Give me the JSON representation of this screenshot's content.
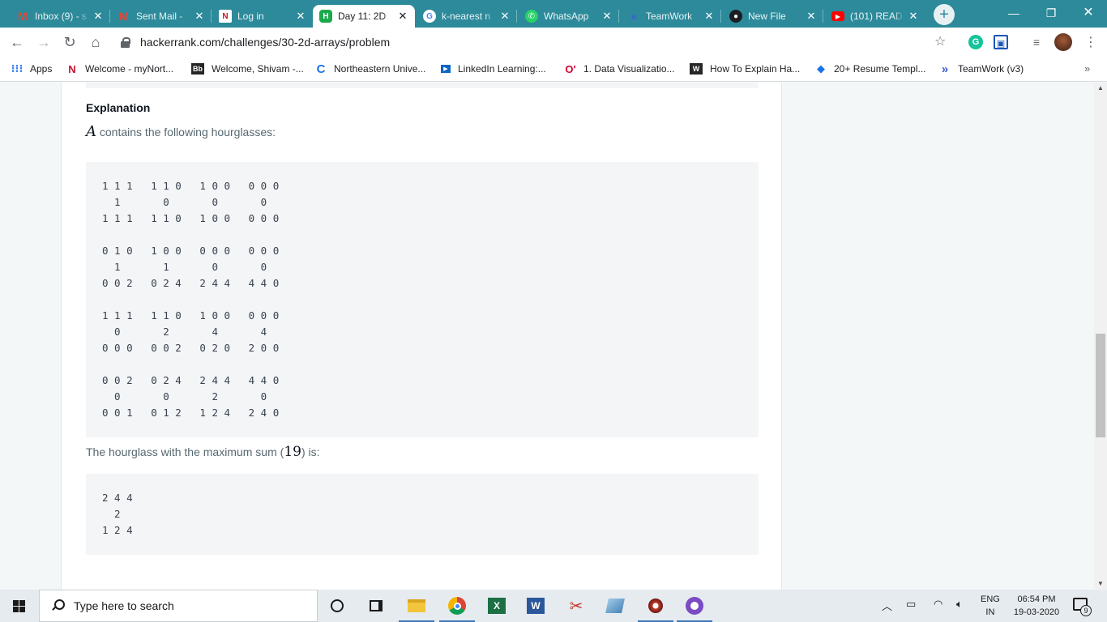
{
  "browser": {
    "tabs": [
      {
        "title": "Inbox (9) - s",
        "icon": "gmail-icon"
      },
      {
        "title": "Sent Mail -",
        "icon": "gmail-icon"
      },
      {
        "title": "Log in",
        "icon": "northeastern-icon"
      },
      {
        "title": "Day 11: 2D",
        "icon": "hackerrank-icon",
        "active": true
      },
      {
        "title": "k-nearest n",
        "icon": "google-icon"
      },
      {
        "title": "WhatsApp",
        "icon": "whatsapp-icon"
      },
      {
        "title": "TeamWork",
        "icon": "teamwork-icon"
      },
      {
        "title": "New File",
        "icon": "github-icon"
      },
      {
        "title": "(101) READ",
        "icon": "youtube-icon"
      }
    ],
    "new_tab_label": "+",
    "url": "hackerrank.com/challenges/30-2d-arrays/problem",
    "bookmarks": [
      {
        "label": "Apps",
        "icon": "apps-grid-icon"
      },
      {
        "label": "Welcome - myNort...",
        "icon": "northeastern-icon"
      },
      {
        "label": "Welcome, Shivam -...",
        "icon": "blackboard-icon"
      },
      {
        "label": "Northeastern Unive...",
        "icon": "northeastern-c-icon"
      },
      {
        "label": "LinkedIn Learning:...",
        "icon": "linkedin-learning-icon"
      },
      {
        "label": "1. Data Visualizatio...",
        "icon": "oreilly-icon"
      },
      {
        "label": "How To Explain Ha...",
        "icon": "wordpress-icon"
      },
      {
        "label": "20+ Resume Templ...",
        "icon": "bookmark-diamond-icon"
      },
      {
        "label": "TeamWork (v3)",
        "icon": "teamwork-icon"
      }
    ],
    "bookmarks_more": "»"
  },
  "page": {
    "heading": "Explanation",
    "intro_var": "A",
    "intro_text": " contains the following hourglasses:",
    "hourglasses": "1 1 1   1 1 0   1 0 0   0 0 0\n  1       0       0       0\n1 1 1   1 1 0   1 0 0   0 0 0\n\n0 1 0   1 0 0   0 0 0   0 0 0\n  1       1       0       0\n0 0 2   0 2 4   2 4 4   4 4 0\n\n1 1 1   1 1 0   1 0 0   0 0 0\n  0       2       4       4\n0 0 0   0 0 2   0 2 0   2 0 0\n\n0 0 2   0 2 4   2 4 4   4 4 0\n  0       0       2       0\n0 0 1   0 1 2   1 2 4   2 4 0",
    "max_prefix": "The hourglass with the maximum sum (",
    "max_value": "19",
    "max_suffix": ") is:",
    "max_hourglass": "2 4 4\n  2\n1 2 4"
  },
  "taskbar": {
    "search_placeholder": "Type here to search",
    "apps": [
      "cortana-icon",
      "task-view-icon",
      "file-explorer-icon",
      "chrome-icon",
      "excel-icon",
      "word-icon",
      "snipping-tool-icon",
      "notepad-icon",
      "app-icon",
      "app-purple-icon"
    ],
    "lang_top": "ENG",
    "lang_bottom": "IN",
    "time": "06:54 PM",
    "date": "19-03-2020",
    "notification_count": "9"
  }
}
